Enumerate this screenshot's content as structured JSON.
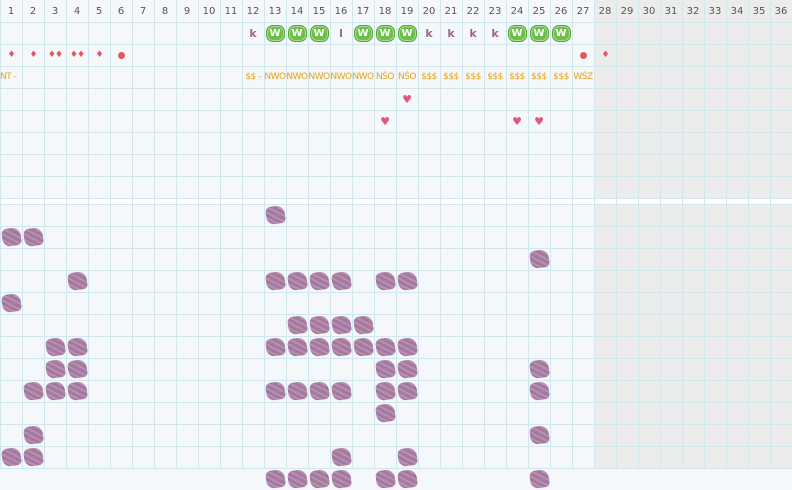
{
  "calendar": {
    "days": [
      "1",
      "2",
      "3",
      "4",
      "5",
      "6",
      "7",
      "8",
      "9",
      "10",
      "11",
      "12",
      "13",
      "14",
      "15",
      "16",
      "17",
      "18",
      "19",
      "20",
      "21",
      "22",
      "23",
      "24",
      "25",
      "26",
      "27",
      "28",
      "29",
      "30",
      "31",
      "32",
      "33",
      "34",
      "35",
      "36"
    ],
    "active_days": 27,
    "colors": {
      "weekend_shade": "#ececec",
      "grid_line": "#d2e6ee",
      "blob": "#a5789f",
      "w_badge": "#6dbf4a",
      "code_text": "#e8a317",
      "drop": "#e05a5a",
      "heart": "#e0587a"
    },
    "top_rows": [
      {
        "kind": "letters",
        "cells": {
          "12": "k",
          "13": "W",
          "14": "W",
          "15": "W",
          "16": "l",
          "17": "W",
          "18": "W",
          "19": "W",
          "20": "k",
          "21": "k",
          "22": "k",
          "23": "k",
          "24": "W",
          "25": "W",
          "26": "W"
        }
      },
      {
        "kind": "markers",
        "cells": {
          "1": "♦",
          "2": "♦",
          "3": "♦♦",
          "4": "♦♦",
          "5": "♦",
          "6": "●",
          "27": "●",
          "28": "♦"
        }
      },
      {
        "kind": "codes",
        "cells": {
          "1": "NT -",
          "12": "$$ -",
          "13": "NWO",
          "14": "NWO",
          "15": "NWO",
          "16": "NWO",
          "17": "NWO",
          "18": "NŚO",
          "19": "NŚO",
          "20": "$$$",
          "21": "$$$",
          "22": "$$$",
          "23": "$$$",
          "24": "$$$",
          "25": "$$$",
          "26": "$$$",
          "27": "WŚZ"
        }
      },
      {
        "kind": "hearts",
        "cells": {
          "19": "♥"
        }
      },
      {
        "kind": "hearts",
        "cells": {
          "18": "♥",
          "24": "♥",
          "25": "♥"
        }
      },
      {
        "kind": "empty",
        "cells": {}
      },
      {
        "kind": "empty",
        "cells": {}
      },
      {
        "kind": "empty",
        "cells": {}
      }
    ],
    "blob_rows": [
      [
        13
      ],
      [
        1,
        2
      ],
      [
        25
      ],
      [
        4,
        13,
        14,
        15,
        16,
        18,
        19
      ],
      [
        1
      ],
      [
        14,
        15,
        16,
        17
      ],
      [
        3,
        4,
        13,
        14,
        15,
        16,
        17,
        18,
        19
      ],
      [
        3,
        4,
        18,
        19,
        25
      ],
      [
        2,
        3,
        4,
        13,
        14,
        15,
        16,
        18,
        19,
        25
      ],
      [
        18
      ],
      [
        2,
        25
      ],
      [
        1,
        2,
        16,
        19
      ],
      [
        13,
        14,
        15,
        16,
        18,
        19,
        25
      ]
    ]
  }
}
